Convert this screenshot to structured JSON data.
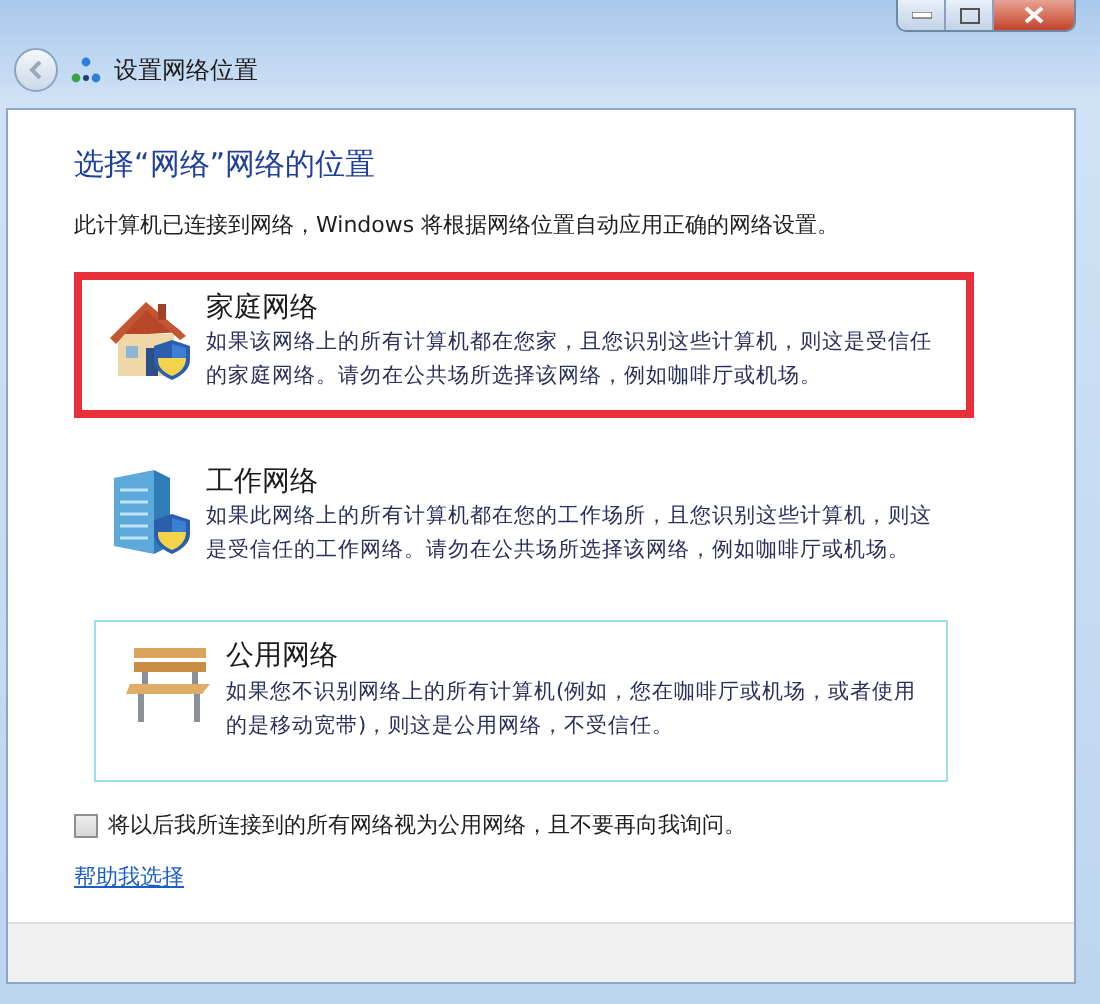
{
  "window": {
    "title": "设置网络位置"
  },
  "heading": "选择“网络”网络的位置",
  "intro": "此计算机已连接到网络，Windows 将根据网络位置自动应用正确的网络设置。",
  "locations": [
    {
      "kind": "home",
      "title": "家庭网络",
      "description": "如果该网络上的所有计算机都在您家，且您识别这些计算机，则这是受信任的家庭网络。请勿在公共场所选择该网络，例如咖啡厅或机场。",
      "annotated": true,
      "focused": false
    },
    {
      "kind": "work",
      "title": "工作网络",
      "description": "如果此网络上的所有计算机都在您的工作场所，且您识别这些计算机，则这是受信任的工作网络。请勿在公共场所选择该网络，例如咖啡厅或机场。",
      "annotated": false,
      "focused": false
    },
    {
      "kind": "public",
      "title": "公用网络",
      "description": "如果您不识别网络上的所有计算机(例如，您在咖啡厅或机场，或者使用的是移动宽带)，则这是公用网络，不受信任。",
      "annotated": false,
      "focused": true
    }
  ],
  "treat_all_public": {
    "label": "将以后我所连接到的所有网络视为公用网络，且不要再向我询问。",
    "checked": false
  },
  "help_link": "帮助我选择"
}
